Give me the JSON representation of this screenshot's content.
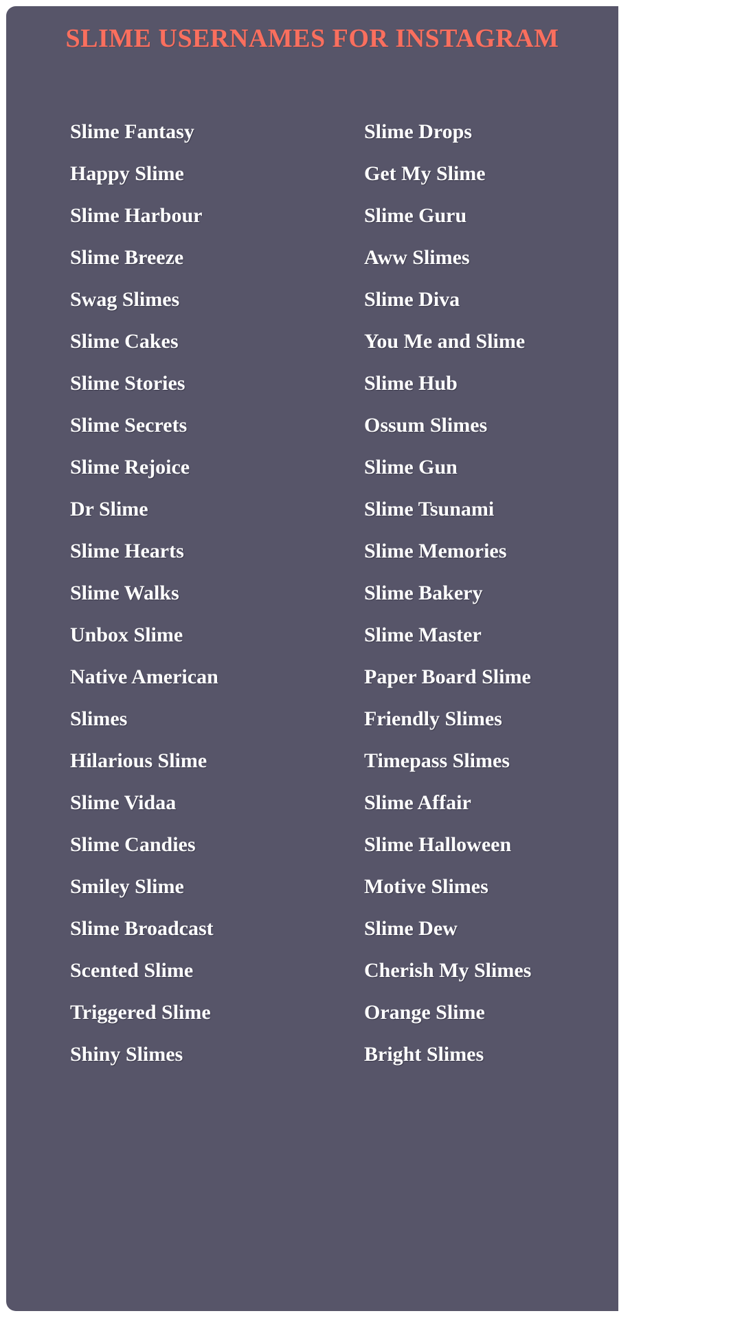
{
  "theme": {
    "card_background": "#575569",
    "page_background": "#ffffff",
    "title_color": "#fa6f5e",
    "entry_color": "#ffffff"
  },
  "header": {
    "title": "SLIME USERNAMES FOR INSTAGRAM"
  },
  "columns": {
    "left": [
      "Slime Fantasy",
      "Happy Slime",
      "Slime Harbour",
      "Slime Breeze",
      "Swag Slimes",
      "Slime Cakes",
      "Slime Stories",
      "Slime Secrets",
      "Slime Rejoice",
      "Dr Slime",
      "Slime Hearts",
      "Slime Walks",
      "Unbox Slime",
      "Native American Slimes",
      "Hilarious Slime",
      "Slime Vidaa",
      "Slime Candies",
      "Smiley Slime",
      "Slime Broadcast",
      "Scented Slime",
      "Triggered Slime",
      "Shiny Slimes"
    ],
    "right": [
      "Slime Drops",
      "Get My Slime",
      "Slime Guru",
      "Aww Slimes",
      "Slime Diva",
      "You Me and Slime",
      "Slime Hub",
      "Ossum Slimes",
      "Slime Gun",
      "Slime Tsunami",
      "Slime Memories",
      "Slime Bakery",
      "Slime Master",
      "Paper Board Slime",
      "Friendly Slimes",
      "Timepass Slimes",
      "Slime Affair",
      "Slime Halloween",
      "Motive Slimes",
      "Slime Dew",
      "Cherish My Slimes",
      "Orange Slime",
      "Bright Slimes"
    ]
  }
}
